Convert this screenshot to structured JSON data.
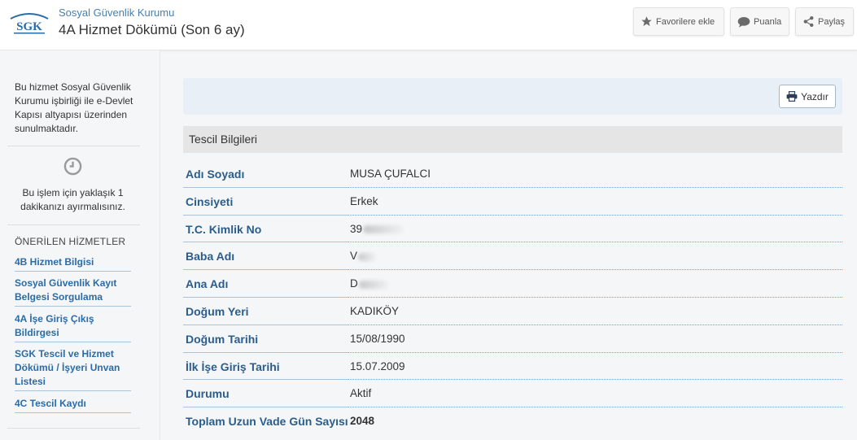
{
  "header": {
    "org_name": "Sosyal Güvenlik Kurumu",
    "title": "4A Hizmet Dökümü (Son 6 ay)",
    "logo_text": "SGK",
    "favorite_label": "Favorilere ekle",
    "rate_label": "Puanla",
    "share_label": "Paylaş"
  },
  "sidebar": {
    "info_text": "Bu hizmet Sosyal Güvenlik Kurumu işbirliği ile e-Devlet Kapısı altyapısı üzerinden sunulmaktadır.",
    "time_text": "Bu işlem için yaklaşık 1 dakikanızı ayırmalısınız.",
    "recommended_heading": "ÖNERİLEN HİZMETLER",
    "links": [
      "4B Hizmet Bilgisi",
      "Sosyal Güvenlik Kayıt Belgesi Sorgulama",
      "4A İşe Giriş Çıkış Bildirgesi",
      "SGK Tescil ve Hizmet Dökümü / İşyeri Unvan Listesi",
      "4C Tescil Kaydı"
    ]
  },
  "content": {
    "print_label": "Yazdır",
    "section_title": "Tescil Bilgileri",
    "rows": [
      {
        "label": "Adı Soyadı",
        "value": "MUSA ÇUFALCI"
      },
      {
        "label": "Cinsiyeti",
        "value": "Erkek"
      },
      {
        "label": "T.C. Kimlik No",
        "value": "39"
      },
      {
        "label": "Baba Adı",
        "value": "V"
      },
      {
        "label": "Ana Adı",
        "value": "D"
      },
      {
        "label": "Doğum Yeri",
        "value": "KADIKÖY"
      },
      {
        "label": "Doğum Tarihi",
        "value": "15/08/1990"
      },
      {
        "label": "İlk İşe Giriş Tarihi",
        "value": "15.07.2009"
      },
      {
        "label": "Durumu",
        "value": "Aktif"
      },
      {
        "label": "Toplam Uzun Vade Gün Sayısı",
        "value": "2048"
      }
    ]
  },
  "colors": {
    "accent": "#2b5d8c",
    "link": "#2a6ca8",
    "org": "#4a7fb0"
  }
}
